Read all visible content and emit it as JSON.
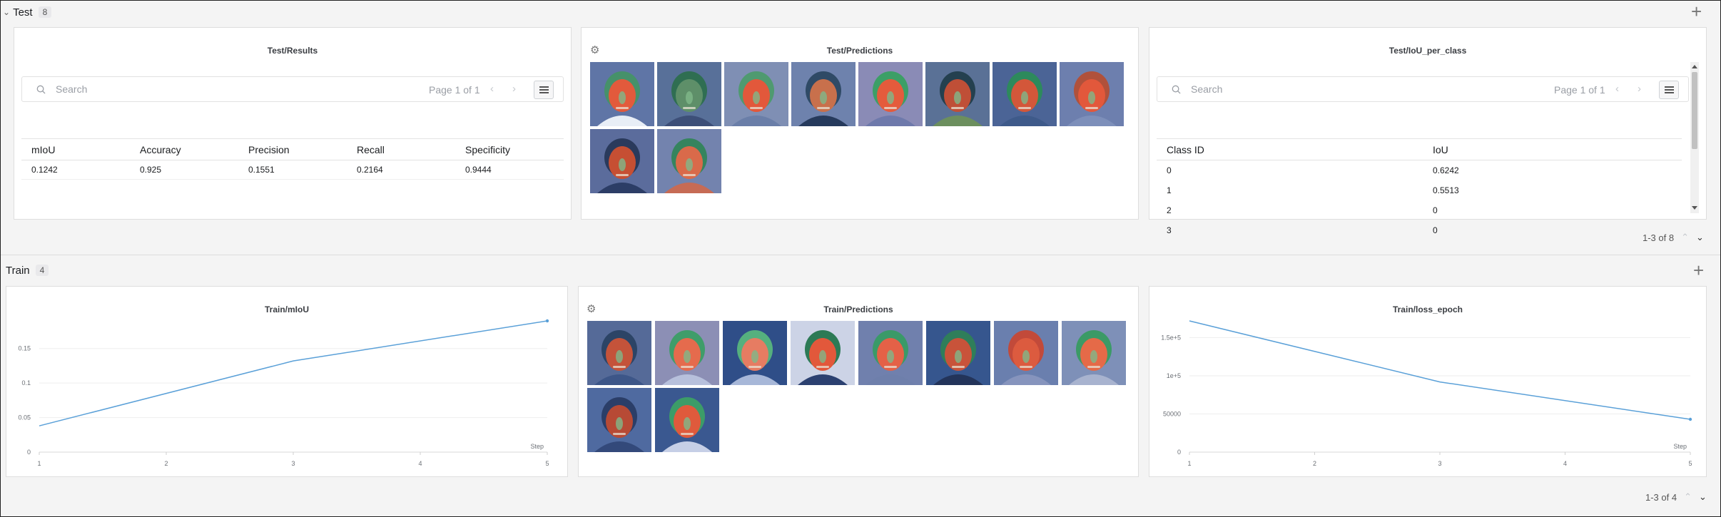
{
  "sections": {
    "test": {
      "title": "Test",
      "count": "8",
      "pager": "1-3 of 8",
      "panels": {
        "results": {
          "title": "Test/Results",
          "search_placeholder": "Search",
          "page_info": "Page 1 of 1",
          "columns": [
            "mIoU",
            "Accuracy",
            "Precision",
            "Recall",
            "Specificity"
          ],
          "rows": [
            [
              "0.1242",
              "0.925",
              "0.1551",
              "0.2164",
              "0.9444"
            ]
          ]
        },
        "predictions": {
          "title": "Test/Predictions",
          "images": [
            {
              "bg": "#5f75a6",
              "face": "#e25a3c",
              "hair": "#46916a",
              "shirt": "#e8eef6"
            },
            {
              "bg": "#587099",
              "face": "#5e8f69",
              "hair": "#2f6e52",
              "shirt": "#3d4f78"
            },
            {
              "bg": "#7f8fb4",
              "face": "#e2583b",
              "hair": "#4f9a70",
              "shirt": "#6a7ea8"
            },
            {
              "bg": "#6e82ad",
              "face": "#c8704c",
              "hair": "#2f4a66",
              "shirt": "#263a5c"
            },
            {
              "bg": "#8a8bb6",
              "face": "#e45b3c",
              "hair": "#3c9f66",
              "shirt": "#6e79ab"
            },
            {
              "bg": "#5a7196",
              "face": "#bf4f37",
              "hair": "#24404f",
              "shirt": "#6c8f5e"
            },
            {
              "bg": "#4b6496",
              "face": "#d3573a",
              "hair": "#2d8a5c",
              "shirt": "#3e5a8a"
            },
            {
              "bg": "#6d7fae",
              "face": "#e2583b",
              "hair": "#b0513b",
              "shirt": "#7d8fba"
            },
            {
              "bg": "#5b6c9c",
              "face": "#c64f33",
              "hair": "#2a3a5c",
              "shirt": "#2c3d66"
            },
            {
              "bg": "#7383ae",
              "face": "#d96a4a",
              "hair": "#35845e",
              "shirt": "#c66b55"
            }
          ]
        },
        "iou": {
          "title": "Test/IoU_per_class",
          "search_placeholder": "Search",
          "page_info": "Page 1 of 1",
          "columns": [
            "Class ID",
            "IoU"
          ],
          "rows": [
            [
              "0",
              "0.6242"
            ],
            [
              "1",
              "0.5513"
            ],
            [
              "2",
              "0"
            ],
            [
              "3",
              "0"
            ]
          ]
        }
      }
    },
    "train": {
      "title": "Train",
      "count": "4",
      "pager": "1-3 of 4",
      "panels": {
        "miou": {
          "title": "Train/mIoU",
          "xlabel": "Step",
          "line_color": "#5aa0d8"
        },
        "predictions": {
          "title": "Train/Predictions",
          "images": [
            {
              "bg": "#556a98",
              "face": "#c4533a",
              "hair": "#2c4466",
              "shirt": "#3d5688"
            },
            {
              "bg": "#8c8fb5",
              "face": "#e56b4d",
              "hair": "#3f9d6a",
              "shirt": "#b7c0dc"
            },
            {
              "bg": "#2f4e88",
              "face": "#e67c62",
              "hair": "#55b07e",
              "shirt": "#a7b7d8"
            },
            {
              "bg": "#ccd3e6",
              "face": "#e2583b",
              "hair": "#2c7a55",
              "shirt": "#2b4070"
            },
            {
              "bg": "#7080ad",
              "face": "#e46147",
              "hair": "#3a9a68",
              "shirt": "#6e7fab"
            },
            {
              "bg": "#36568e",
              "face": "#c8533a",
              "hair": "#2f7e5a",
              "shirt": "#23345a"
            },
            {
              "bg": "#6a7fae",
              "face": "#dc5b3f",
              "hair": "#c24a3a",
              "shirt": "#8694bd"
            },
            {
              "bg": "#7e90b8",
              "face": "#e56a48",
              "hair": "#3b9a66",
              "shirt": "#a8b3cf"
            },
            {
              "bg": "#4f6aa0",
              "face": "#b74a35",
              "hair": "#2b3e68",
              "shirt": "#33497a"
            },
            {
              "bg": "#3a5890",
              "face": "#df5a3c",
              "hair": "#3c9c68",
              "shirt": "#c6cfe6"
            }
          ]
        },
        "loss": {
          "title": "Train/loss_epoch",
          "xlabel": "Step",
          "line_color": "#5aa0d8"
        }
      }
    }
  },
  "chart_data": [
    {
      "type": "line",
      "title": "Train/mIoU",
      "xlabel": "Step",
      "ylabel": "",
      "x": [
        1,
        3,
        5
      ],
      "series": [
        {
          "values": [
            0.038,
            0.132,
            0.19
          ]
        }
      ],
      "xlim": [
        1,
        5
      ],
      "ylim": [
        0,
        0.19
      ],
      "xticks": [
        "1",
        "2",
        "3",
        "4",
        "5"
      ],
      "yticks": [
        {
          "v": 0,
          "label": "0"
        },
        {
          "v": 0.05,
          "label": "0.05"
        },
        {
          "v": 0.1,
          "label": "0.1"
        },
        {
          "v": 0.15,
          "label": "0.15"
        }
      ],
      "grid": true
    },
    {
      "type": "line",
      "title": "Train/loss_epoch",
      "xlabel": "Step",
      "ylabel": "",
      "x": [
        1,
        3,
        5
      ],
      "series": [
        {
          "values": [
            172000,
            92000,
            43000
          ]
        }
      ],
      "xlim": [
        1,
        5
      ],
      "ylim": [
        0,
        172000
      ],
      "xticks": [
        "1",
        "2",
        "3",
        "4",
        "5"
      ],
      "yticks": [
        {
          "v": 0,
          "label": "0"
        },
        {
          "v": 50000,
          "label": "50000"
        },
        {
          "v": 100000,
          "label": "1e+5"
        },
        {
          "v": 150000,
          "label": "1.5e+5"
        }
      ],
      "grid": true
    }
  ]
}
